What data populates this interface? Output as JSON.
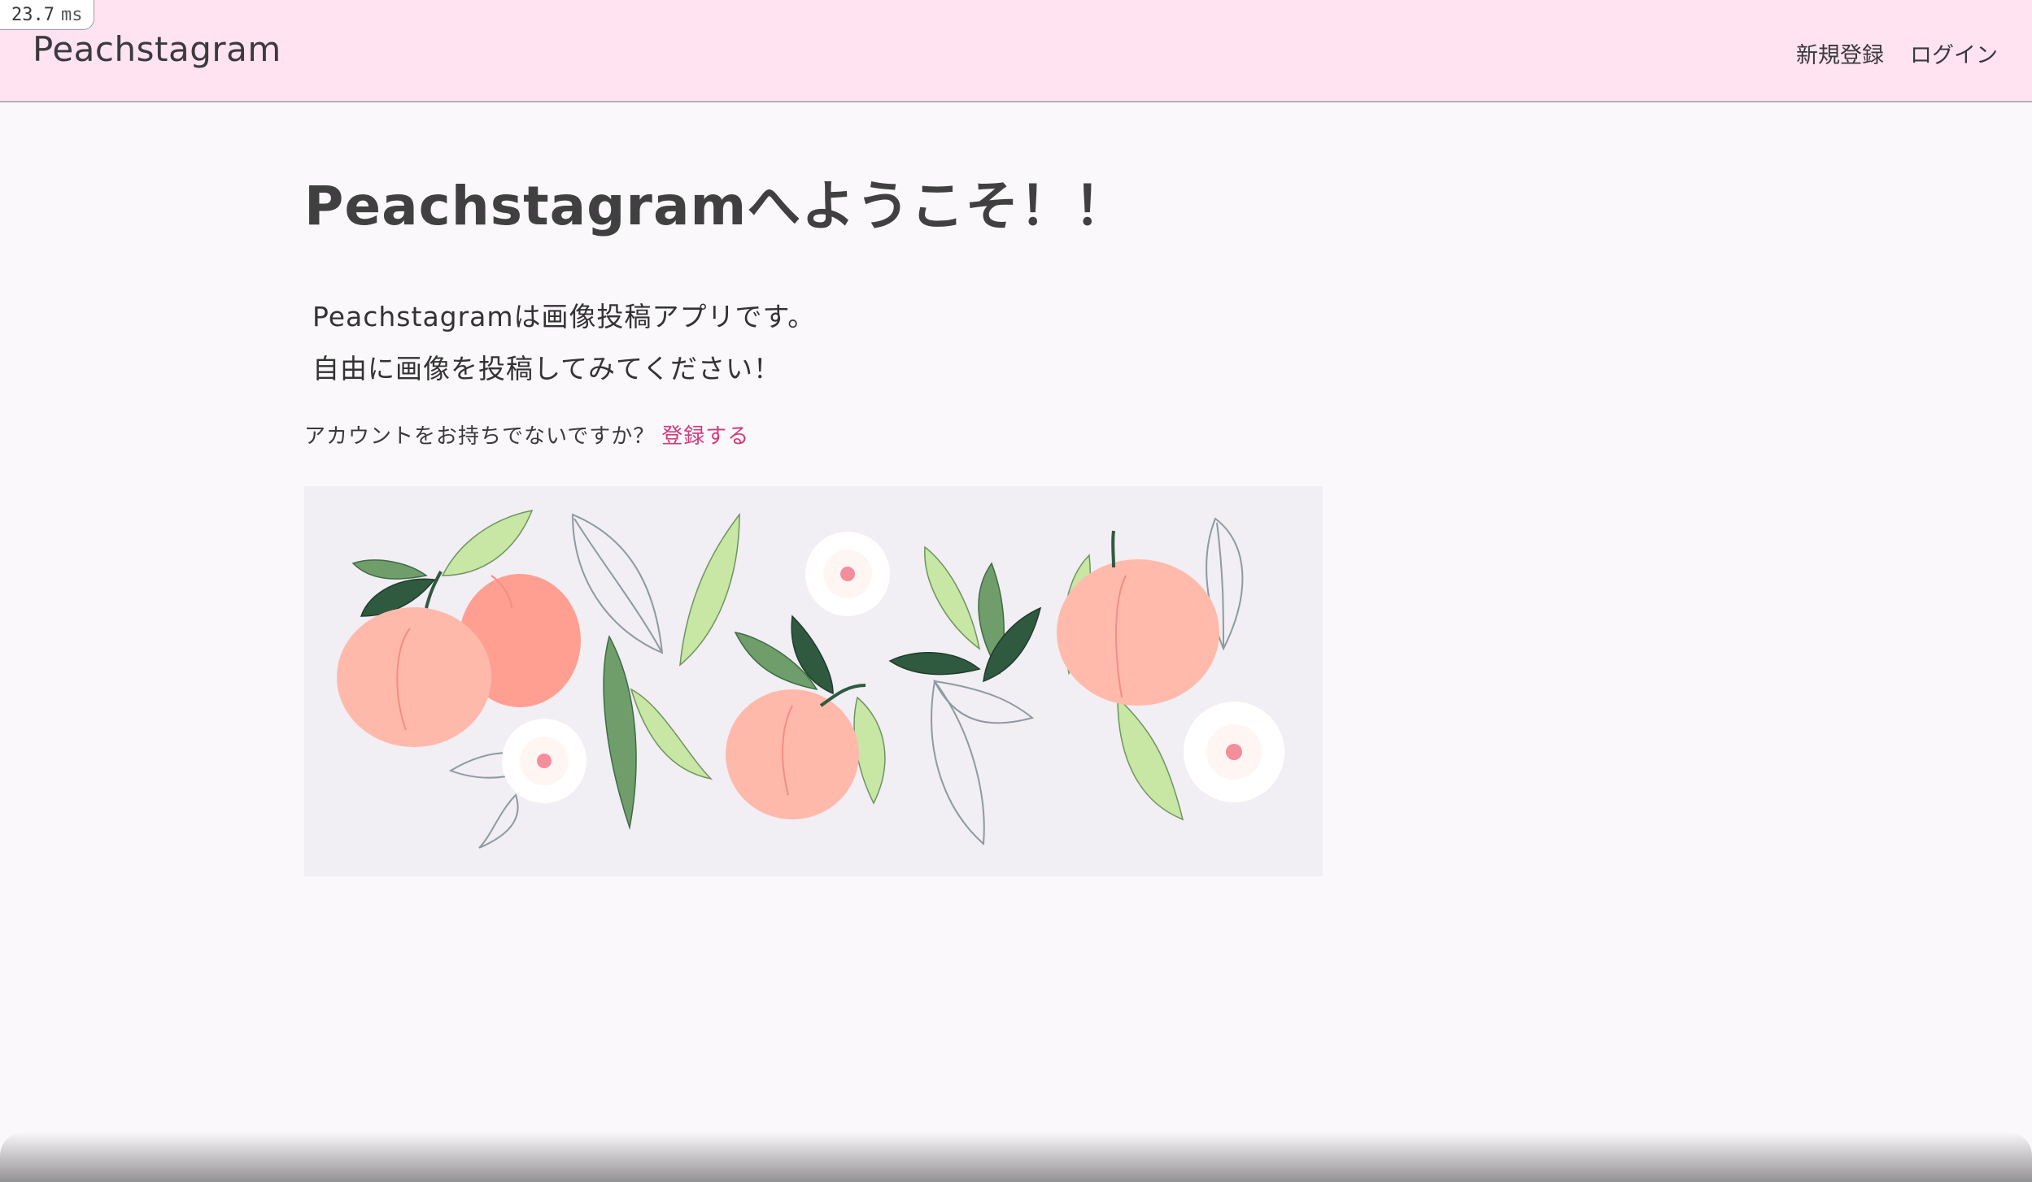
{
  "perf": {
    "value": "23.7",
    "unit": "ms"
  },
  "navbar": {
    "brand": "Peachstagram",
    "links": {
      "signup": "新規登録",
      "login": "ログイン"
    }
  },
  "main": {
    "title": "Peachstagramへようこそ！！",
    "description": [
      "Peachstagramは画像投稿アプリです。",
      "自由に画像を投稿してみてください！"
    ],
    "signup_prompt": "アカウントをお持ちでないですか？",
    "signup_link": "登録する"
  },
  "colors": {
    "navbar_bg": "#ffe3f1",
    "page_bg": "#fbf8fc",
    "link_accent": "#d23a7a",
    "peach": "#ffb4a6",
    "leaf_light": "#c8e6a4",
    "leaf_dark": "#2f5a40"
  },
  "hero_image": {
    "subject": "peaches, leaves and white blossoms illustration"
  }
}
